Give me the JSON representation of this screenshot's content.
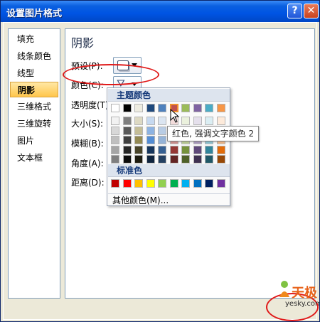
{
  "window": {
    "title": "设置图片格式"
  },
  "titlebar": {
    "help_glyph": "?",
    "close_glyph": "✕"
  },
  "sidebar": {
    "items": [
      {
        "label": "填充"
      },
      {
        "label": "线条颜色"
      },
      {
        "label": "线型"
      },
      {
        "label": "阴影",
        "selected": true
      },
      {
        "label": "三维格式"
      },
      {
        "label": "三维旋转"
      },
      {
        "label": "图片"
      },
      {
        "label": "文本框"
      }
    ]
  },
  "panel": {
    "heading": "阴影",
    "fields": {
      "preset": "预设(P):",
      "color": "颜色(C):",
      "transparency": "透明度(T):",
      "size": "大小(S):",
      "blur": "模糊(B):",
      "angle": "角度(A):",
      "distance": "距离(D):"
    }
  },
  "color_picker": {
    "theme_header": "主题颜色",
    "standard_header": "标准色",
    "more_colors": "其他颜色(M)...",
    "tooltip": "红色, 强调文字颜色 2",
    "theme_colors": [
      "#ffffff",
      "#000000",
      "#eeece1",
      "#1f497d",
      "#4f81bd",
      "#c0504d",
      "#9bbb59",
      "#8064a2",
      "#4bacc6",
      "#f79646"
    ],
    "theme_shades": [
      [
        "#f2f2f2",
        "#7f7f7f",
        "#ddd9c3",
        "#c6d9f0",
        "#dbe5f1",
        "#f2dcdb",
        "#ebf1dd",
        "#e5e0ec",
        "#dbeef3",
        "#fdeada"
      ],
      [
        "#d8d8d8",
        "#595959",
        "#c4bd97",
        "#8db3e2",
        "#b8cce4",
        "#e5b9b7",
        "#d7e3bc",
        "#ccc1d9",
        "#b7dde8",
        "#fbd5b5"
      ],
      [
        "#bfbfbf",
        "#3f3f3f",
        "#938953",
        "#548dd4",
        "#95b3d7",
        "#d99694",
        "#c3d69b",
        "#b2a2c7",
        "#92cddc",
        "#fac08f"
      ],
      [
        "#a5a5a5",
        "#262626",
        "#494429",
        "#17365d",
        "#366092",
        "#953734",
        "#76923c",
        "#5f497a",
        "#31859b",
        "#e36c09"
      ],
      [
        "#7f7f7f",
        "#0c0c0c",
        "#1d1b10",
        "#0f243e",
        "#244061",
        "#632423",
        "#4f6128",
        "#3f3151",
        "#205867",
        "#974806"
      ]
    ],
    "standard_colors": [
      "#c00000",
      "#ff0000",
      "#ffc000",
      "#ffff00",
      "#92d050",
      "#00b050",
      "#00b0f0",
      "#0070c0",
      "#002060",
      "#7030a0"
    ],
    "selected_theme_index": 5
  },
  "watermark": {
    "brand": "天极",
    "url": "yesky.com"
  }
}
